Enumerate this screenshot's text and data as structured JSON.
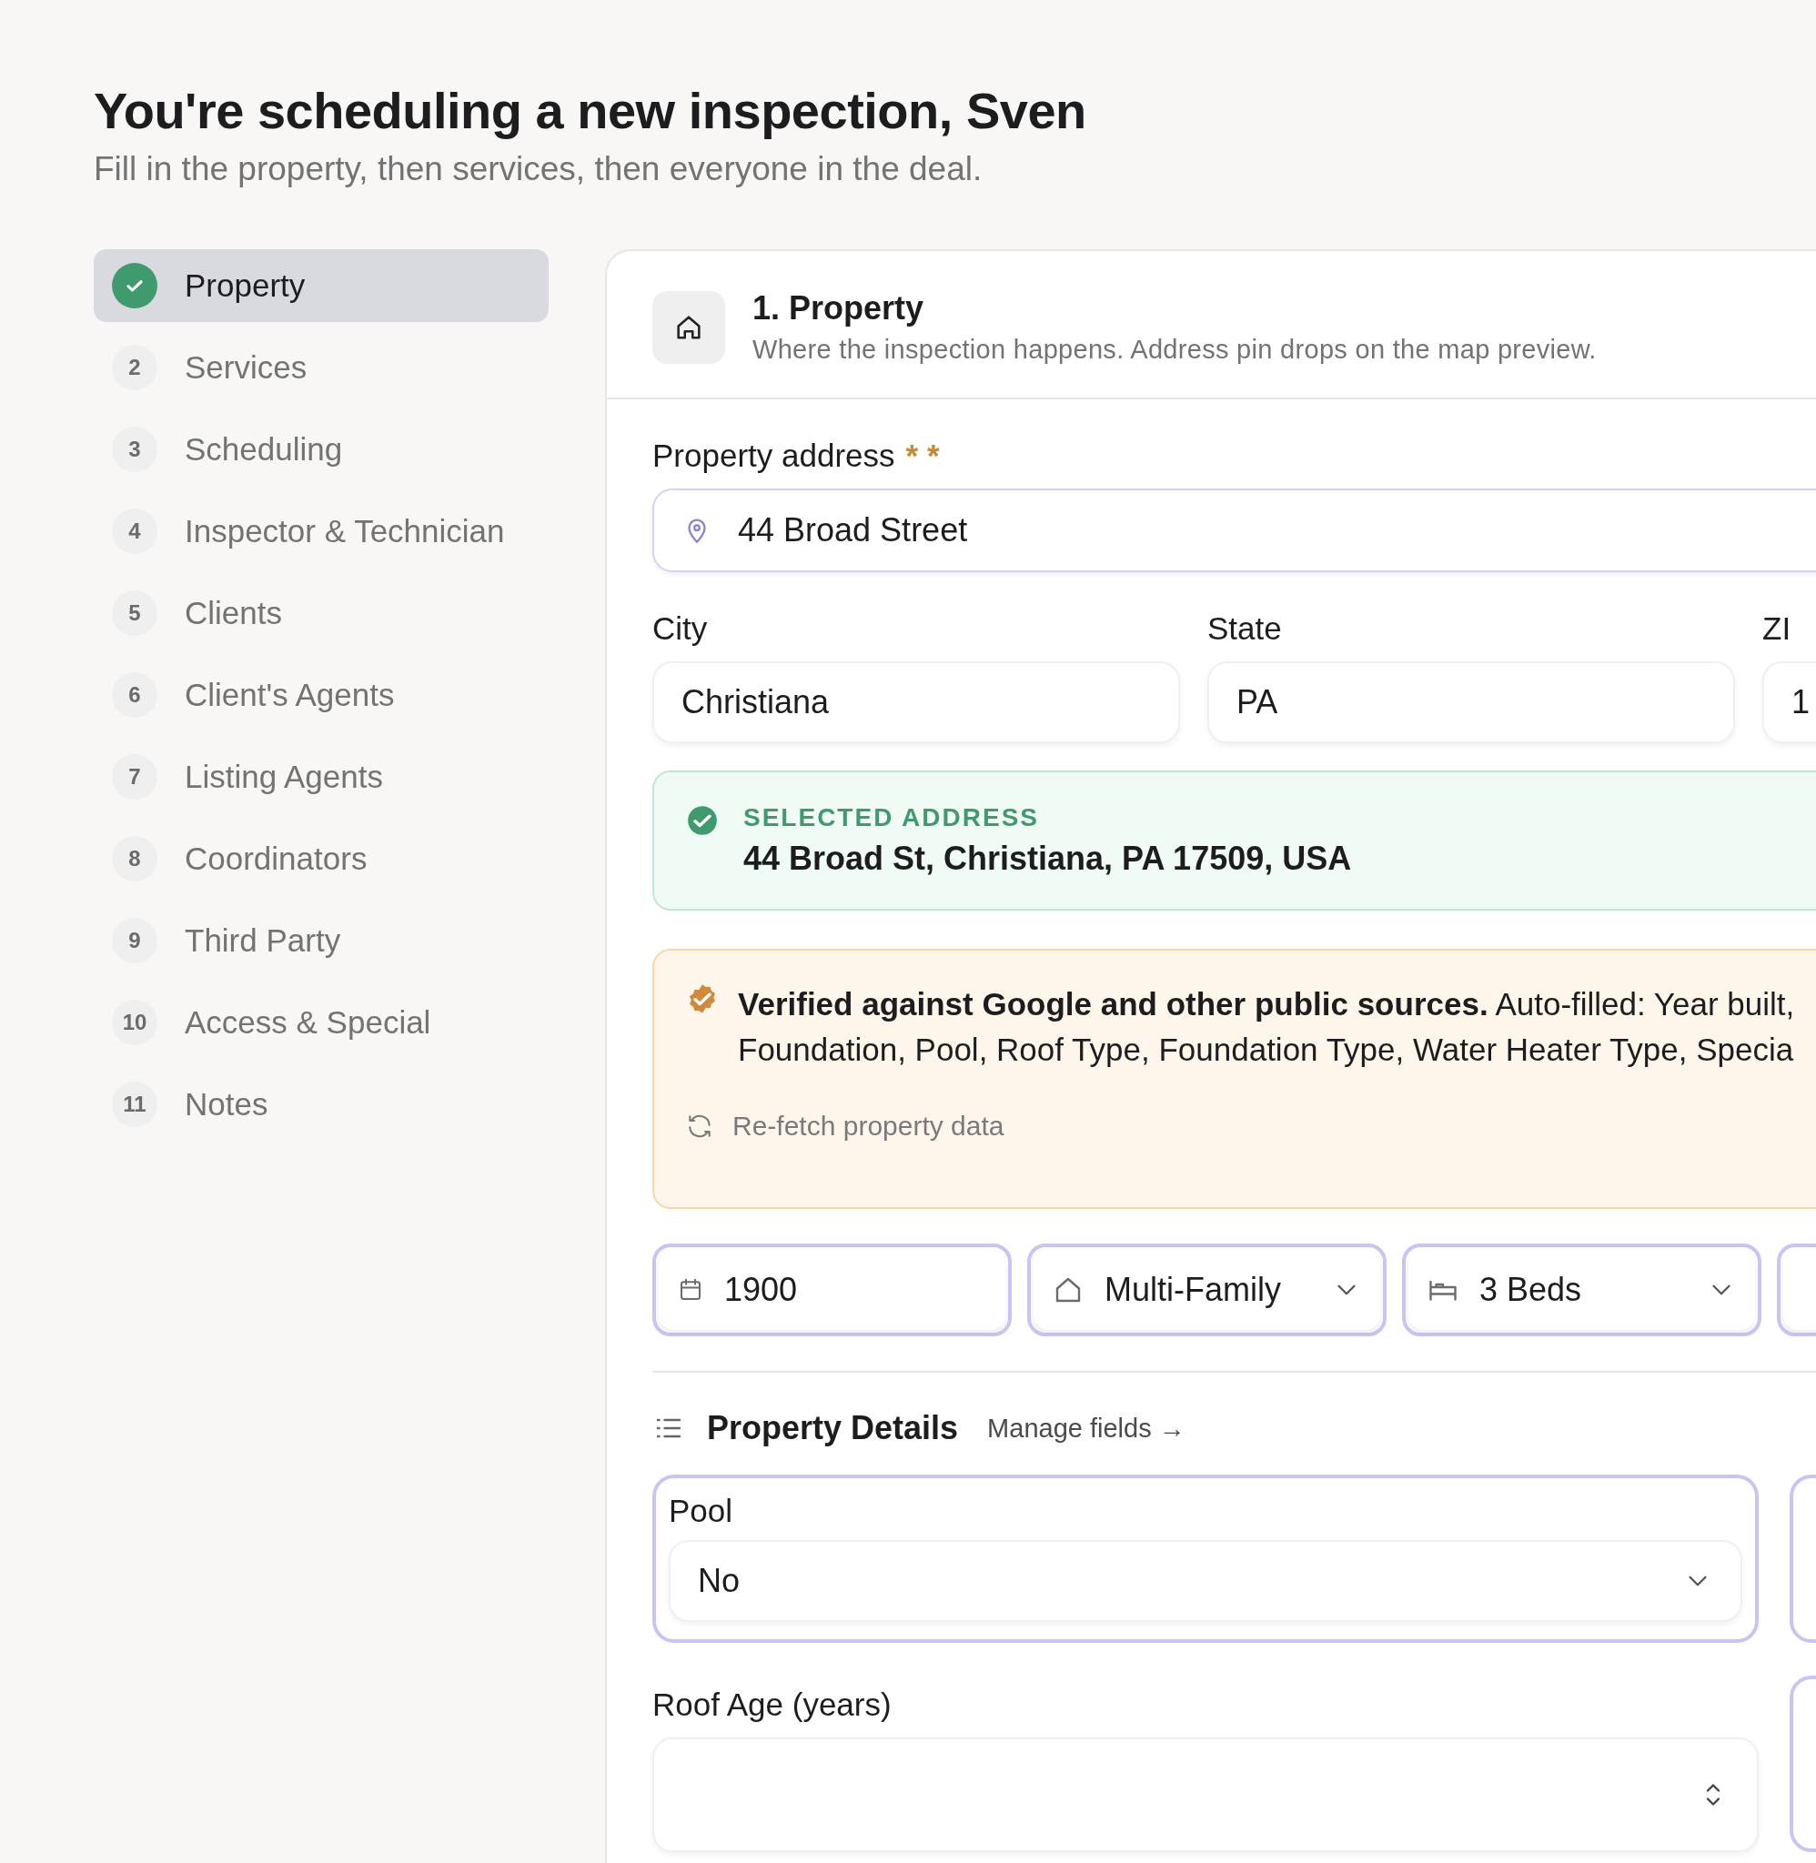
{
  "header": {
    "title": "You're scheduling a new inspection, Sven",
    "subtitle": "Fill in the property, then services, then everyone in the deal."
  },
  "steps": [
    {
      "label": "Property",
      "selected": true,
      "completed": true
    },
    {
      "number": "2",
      "label": "Services",
      "selected": false,
      "completed": false
    },
    {
      "number": "3",
      "label": "Scheduling",
      "selected": false,
      "completed": false
    },
    {
      "number": "4",
      "label": "Inspector & Technician",
      "selected": false,
      "completed": false
    },
    {
      "number": "5",
      "label": "Clients",
      "selected": false,
      "completed": false
    },
    {
      "number": "6",
      "label": "Client's Agents",
      "selected": false,
      "completed": false
    },
    {
      "number": "7",
      "label": "Listing Agents",
      "selected": false,
      "completed": false
    },
    {
      "number": "8",
      "label": "Coordinators",
      "selected": false,
      "completed": false
    },
    {
      "number": "9",
      "label": "Third Party",
      "selected": false,
      "completed": false
    },
    {
      "number": "10",
      "label": "Access & Special",
      "selected": false,
      "completed": false
    },
    {
      "number": "11",
      "label": "Notes",
      "selected": false,
      "completed": false
    }
  ],
  "section": {
    "title": "1. Property",
    "description": "Where the inspection happens. Address pin drops on the map preview."
  },
  "address": {
    "label": "Property address",
    "required_mark": "* *",
    "value": "44 Broad Street"
  },
  "location_fields": [
    {
      "label": "City",
      "value": "Christiana"
    },
    {
      "label": "State",
      "value": "PA"
    },
    {
      "label": "ZI",
      "value": "1"
    }
  ],
  "selected_address": {
    "caption": "SELECTED ADDRESS",
    "value": "44 Broad St, Christiana, PA 17509, USA"
  },
  "verification": {
    "lines": [
      "**Verified against Google and other public sources.** Auto-filled: Year built,",
      "Foundation, Pool, Roof Type, Foundation Type, Water Heater Type, Specia"
    ],
    "action": "Re-fetch property data"
  },
  "quick_fields": [
    {
      "kind": "year",
      "value": "1900",
      "dropdown": false
    },
    {
      "kind": "type",
      "value": "Multi-Family",
      "dropdown": true
    },
    {
      "kind": "beds",
      "value": "3 Beds",
      "dropdown": true
    },
    {
      "kind": "other",
      "dropdown": false
    }
  ],
  "details": {
    "title": "Property Details",
    "link": "Manage fields →",
    "fields": [
      {
        "kind": "select",
        "label": "Pool",
        "value": "No"
      },
      {
        "kind": "partial"
      },
      {
        "kind": "number",
        "label": "Roof Age (years)"
      },
      {
        "kind": "partial"
      }
    ]
  }
}
